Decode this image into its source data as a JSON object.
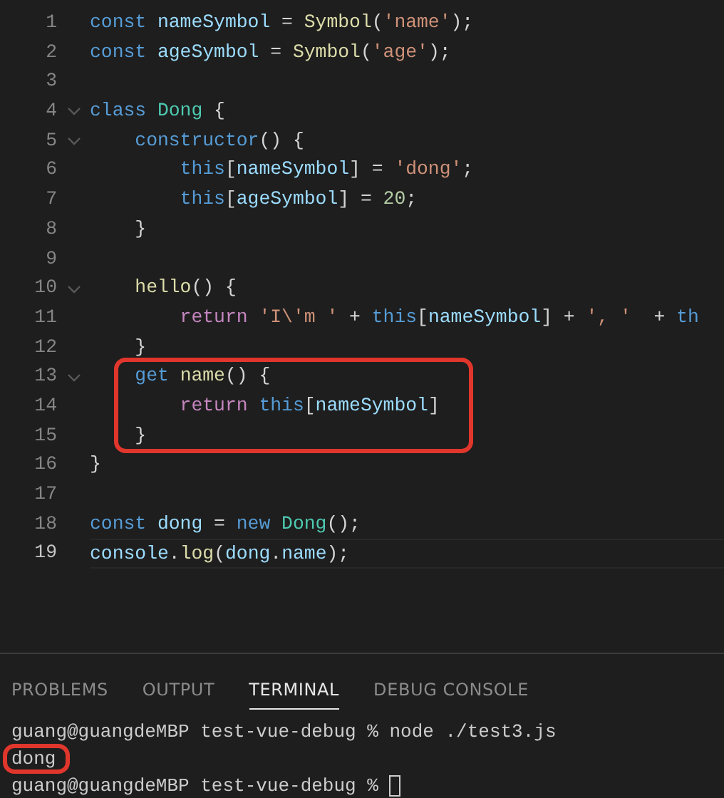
{
  "editor": {
    "lines": [
      {
        "number": "1",
        "current": false,
        "foldable": false,
        "highlighted": false,
        "tokens": [
          {
            "kind": "kw",
            "text": "const "
          },
          {
            "kind": "var",
            "text": "nameSymbol"
          },
          {
            "kind": "punc",
            "text": " = "
          },
          {
            "kind": "fn",
            "text": "Symbol"
          },
          {
            "kind": "punc",
            "text": "("
          },
          {
            "kind": "str",
            "text": "'name'"
          },
          {
            "kind": "punc",
            "text": ");"
          }
        ]
      },
      {
        "number": "2",
        "current": false,
        "foldable": false,
        "highlighted": false,
        "tokens": [
          {
            "kind": "kw",
            "text": "const "
          },
          {
            "kind": "var",
            "text": "ageSymbol"
          },
          {
            "kind": "punc",
            "text": " = "
          },
          {
            "kind": "fn",
            "text": "Symbol"
          },
          {
            "kind": "punc",
            "text": "("
          },
          {
            "kind": "str",
            "text": "'age'"
          },
          {
            "kind": "punc",
            "text": ");"
          }
        ]
      },
      {
        "number": "3",
        "current": false,
        "foldable": false,
        "highlighted": false
      },
      {
        "number": "4",
        "current": false,
        "foldable": true,
        "highlighted": false,
        "tokens": [
          {
            "kind": "kw",
            "text": "class "
          },
          {
            "kind": "cls",
            "text": "Dong"
          },
          {
            "kind": "punc",
            "text": " {"
          }
        ]
      },
      {
        "number": "5",
        "current": false,
        "foldable": true,
        "highlighted": false,
        "tokens": [
          {
            "kind": "kw",
            "text": "    constructor"
          },
          {
            "kind": "punc",
            "text": "() {"
          }
        ]
      },
      {
        "number": "6",
        "current": false,
        "foldable": false,
        "highlighted": false,
        "tokens": [
          {
            "kind": "kw",
            "text": "        this"
          },
          {
            "kind": "punc",
            "text": "["
          },
          {
            "kind": "var",
            "text": "nameSymbol"
          },
          {
            "kind": "punc",
            "text": "] = "
          },
          {
            "kind": "str",
            "text": "'dong'"
          },
          {
            "kind": "punc",
            "text": ";"
          }
        ]
      },
      {
        "number": "7",
        "current": false,
        "foldable": false,
        "highlighted": false,
        "tokens": [
          {
            "kind": "kw",
            "text": "        this"
          },
          {
            "kind": "punc",
            "text": "["
          },
          {
            "kind": "var",
            "text": "ageSymbol"
          },
          {
            "kind": "punc",
            "text": "] = "
          },
          {
            "kind": "num",
            "text": "20"
          },
          {
            "kind": "punc",
            "text": ";"
          }
        ]
      },
      {
        "number": "8",
        "current": false,
        "foldable": false,
        "highlighted": false,
        "tokens": [
          {
            "kind": "punc",
            "text": "    }"
          }
        ]
      },
      {
        "number": "9",
        "current": false,
        "foldable": false,
        "highlighted": false
      },
      {
        "number": "10",
        "current": false,
        "foldable": true,
        "highlighted": false,
        "tokens": [
          {
            "kind": "fn",
            "text": "    hello"
          },
          {
            "kind": "punc",
            "text": "() {"
          }
        ]
      },
      {
        "number": "11",
        "current": false,
        "foldable": false,
        "highlighted": false,
        "tokens": [
          {
            "kind": "ctrl",
            "text": "        return "
          },
          {
            "kind": "str",
            "text": "'I\\'m '"
          },
          {
            "kind": "punc",
            "text": " + "
          },
          {
            "kind": "kw",
            "text": "this"
          },
          {
            "kind": "punc",
            "text": "["
          },
          {
            "kind": "var",
            "text": "nameSymbol"
          },
          {
            "kind": "punc",
            "text": "] + "
          },
          {
            "kind": "str",
            "text": "', '"
          },
          {
            "kind": "punc",
            "text": "  + "
          },
          {
            "kind": "kw",
            "text": "th"
          }
        ]
      },
      {
        "number": "12",
        "current": false,
        "foldable": false,
        "highlighted": false,
        "tokens": [
          {
            "kind": "punc",
            "text": "    }"
          }
        ]
      },
      {
        "number": "13",
        "current": false,
        "foldable": true,
        "highlighted": true,
        "tokens": [
          {
            "kind": "kw",
            "text": "    get "
          },
          {
            "kind": "fn",
            "text": "name"
          },
          {
            "kind": "punc",
            "text": "() {"
          }
        ]
      },
      {
        "number": "14",
        "current": false,
        "foldable": false,
        "highlighted": true,
        "tokens": [
          {
            "kind": "ctrl",
            "text": "        return "
          },
          {
            "kind": "kw",
            "text": "this"
          },
          {
            "kind": "punc",
            "text": "["
          },
          {
            "kind": "var",
            "text": "nameSymbol"
          },
          {
            "kind": "punc",
            "text": "]"
          }
        ]
      },
      {
        "number": "15",
        "current": false,
        "foldable": false,
        "highlighted": true,
        "tokens": [
          {
            "kind": "punc",
            "text": "    }"
          }
        ]
      },
      {
        "number": "16",
        "current": false,
        "foldable": false,
        "highlighted": false,
        "tokens": [
          {
            "kind": "punc",
            "text": "}"
          }
        ]
      },
      {
        "number": "17",
        "current": false,
        "foldable": false,
        "highlighted": false
      },
      {
        "number": "18",
        "current": false,
        "foldable": false,
        "highlighted": false,
        "tokens": [
          {
            "kind": "kw",
            "text": "const "
          },
          {
            "kind": "var",
            "text": "dong"
          },
          {
            "kind": "punc",
            "text": " = "
          },
          {
            "kind": "kw",
            "text": "new "
          },
          {
            "kind": "cls",
            "text": "Dong"
          },
          {
            "kind": "punc",
            "text": "();"
          }
        ]
      },
      {
        "number": "19",
        "current": true,
        "foldable": false,
        "highlighted": false,
        "tokens": [
          {
            "kind": "var",
            "text": "console"
          },
          {
            "kind": "punc",
            "text": "."
          },
          {
            "kind": "fn",
            "text": "log"
          },
          {
            "kind": "punc",
            "text": "("
          },
          {
            "kind": "var",
            "text": "dong"
          },
          {
            "kind": "punc",
            "text": "."
          },
          {
            "kind": "var",
            "text": "name"
          },
          {
            "kind": "punc",
            "text": ");"
          }
        ]
      }
    ]
  },
  "panel": {
    "tabs": [
      {
        "label": "PROBLEMS",
        "selected": false
      },
      {
        "label": "OUTPUT",
        "selected": false
      },
      {
        "label": "TERMINAL",
        "selected": true
      },
      {
        "label": "DEBUG CONSOLE",
        "selected": false
      }
    ],
    "terminal": [
      {
        "text": "guang@guangdeMBP test-vue-debug % node ./test3.js",
        "highlighted": false,
        "cursor": false
      },
      {
        "text": "dong",
        "highlighted": true,
        "cursor": false
      },
      {
        "text": "guang@guangdeMBP test-vue-debug % ",
        "highlighted": false,
        "cursor": true
      }
    ]
  }
}
